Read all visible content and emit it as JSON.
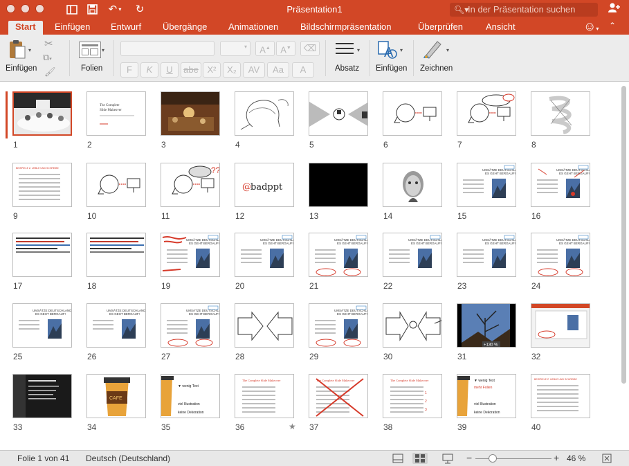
{
  "app": {
    "title": "Präsentation1",
    "search_placeholder": "In der Präsentation suchen",
    "accent_color": "#d24726"
  },
  "tabs": [
    {
      "label": "Start",
      "active": true
    },
    {
      "label": "Einfügen"
    },
    {
      "label": "Entwurf"
    },
    {
      "label": "Übergänge"
    },
    {
      "label": "Animationen"
    },
    {
      "label": "Bildschirmpräsentation"
    },
    {
      "label": "Überprüfen"
    },
    {
      "label": "Ansicht"
    }
  ],
  "ribbon": {
    "paste_label": "Einfügen",
    "slides_label": "Folien",
    "paragraph_label": "Absatz",
    "insert_label": "Einfügen",
    "draw_label": "Zeichnen",
    "format_buttons": [
      "F",
      "K",
      "U",
      "abe",
      "X²",
      "X₂",
      "AV",
      "Aa",
      "A"
    ]
  },
  "slides": [
    {
      "number": "1",
      "kind": "photo-meeting",
      "selected": true
    },
    {
      "number": "2",
      "kind": "title-text",
      "title": "The Complete Slide Makeover"
    },
    {
      "number": "3",
      "kind": "photo-painting"
    },
    {
      "number": "4",
      "kind": "sketch-head"
    },
    {
      "number": "5",
      "kind": "diagram-arrows-gray"
    },
    {
      "number": "6",
      "kind": "sketch-head-screen"
    },
    {
      "number": "7",
      "kind": "sketch-head-cloud"
    },
    {
      "number": "8",
      "kind": "scribble"
    },
    {
      "number": "9",
      "kind": "text-bullets-red"
    },
    {
      "number": "10",
      "kind": "sketch-head-screen"
    },
    {
      "number": "11",
      "kind": "sketch-head-question"
    },
    {
      "number": "12",
      "kind": "handle",
      "text": "@badppt"
    },
    {
      "number": "13",
      "kind": "black"
    },
    {
      "number": "14",
      "kind": "portrait"
    },
    {
      "number": "15",
      "kind": "template-bullets"
    },
    {
      "number": "16",
      "kind": "template-bullets-red"
    },
    {
      "number": "17",
      "kind": "dense-text"
    },
    {
      "number": "18",
      "kind": "dense-text"
    },
    {
      "number": "19",
      "kind": "template-bullets-scribble"
    },
    {
      "number": "20",
      "kind": "template-bullets"
    },
    {
      "number": "21",
      "kind": "template-bullets-circle"
    },
    {
      "number": "22",
      "kind": "template-bullets"
    },
    {
      "number": "23",
      "kind": "template-bullets"
    },
    {
      "number": "24",
      "kind": "template-bullets-circle"
    },
    {
      "number": "25",
      "kind": "template-plain"
    },
    {
      "number": "26",
      "kind": "template-plain"
    },
    {
      "number": "27",
      "kind": "template-bullets-circle"
    },
    {
      "number": "28",
      "kind": "diagram-arrows"
    },
    {
      "number": "29",
      "kind": "template-bullets-circle"
    },
    {
      "number": "30",
      "kind": "diagram-arrows-head"
    },
    {
      "number": "31",
      "kind": "photo-tree",
      "badge": "+130 %"
    },
    {
      "number": "32",
      "kind": "screenshot-template"
    },
    {
      "number": "33",
      "kind": "dark-text"
    },
    {
      "number": "34",
      "kind": "coffee-cup"
    },
    {
      "number": "35",
      "kind": "cup-list",
      "items": [
        "wenig Text",
        "viel Illustration",
        "keine Dekoration"
      ]
    },
    {
      "number": "36",
      "kind": "title-text-list",
      "star": true
    },
    {
      "number": "37",
      "kind": "title-text-crossed"
    },
    {
      "number": "38",
      "kind": "title-text-marked"
    },
    {
      "number": "39",
      "kind": "cup-list-red",
      "items": [
        "wenig Text",
        "mehr Folien",
        "viel Illustration",
        "keine Dekoration"
      ]
    },
    {
      "number": "40",
      "kind": "text-bullets-red"
    }
  ],
  "status": {
    "slide_info": "Folie 1 von 41",
    "language": "Deutsch (Deutschland)",
    "zoom": "46 %",
    "zoom_fraction": 0.46
  },
  "icons": [
    "close-icon",
    "minimize-icon",
    "maximize-icon",
    "sidebar-icon",
    "save-icon",
    "undo-icon",
    "redo-icon",
    "search-icon",
    "add-user-icon",
    "smiley-icon",
    "collapse-icon",
    "paste-icon",
    "cut-icon",
    "copy-icon",
    "format-painter-icon",
    "new-slide-icon",
    "paragraph-icon",
    "shapes-icon",
    "draw-icon",
    "normal-view-icon",
    "sorter-view-icon",
    "presenter-view-icon",
    "fit-icon"
  ]
}
